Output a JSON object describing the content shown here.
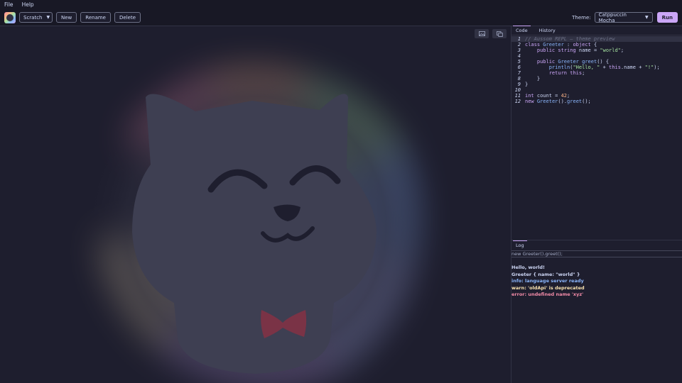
{
  "menu": {
    "file": "File",
    "help": "Help"
  },
  "toolbar": {
    "scratch_select": "Scratch",
    "new": "New",
    "rename": "Rename",
    "delete": "Delete",
    "theme_label": "Theme:",
    "theme_value": "Catppuccin Mocha",
    "run": "Run"
  },
  "editor": {
    "tabs": [
      "Code",
      "History"
    ],
    "lines": [
      {
        "n": "1",
        "text": "// Aussom REPL — theme preview"
      },
      {
        "n": "2",
        "text": "class Greeter : object {"
      },
      {
        "n": "3",
        "text": "    public string name = \"world\";"
      },
      {
        "n": "4",
        "text": ""
      },
      {
        "n": "5",
        "text": "    public Greeter greet() {"
      },
      {
        "n": "6",
        "text": "        println(\"Hello, \" + this.name + \"!\");"
      },
      {
        "n": "7",
        "text": "        return this;"
      },
      {
        "n": "8",
        "text": "    }"
      },
      {
        "n": "9",
        "text": "}"
      },
      {
        "n": "10",
        "text": ""
      },
      {
        "n": "11",
        "text": "int count = 42;"
      },
      {
        "n": "12",
        "text": "new Greeter().greet();"
      }
    ]
  },
  "log": {
    "tab": "Log",
    "input_value": "new Greeter().greet();",
    "lines": [
      {
        "text": "Hello, world!",
        "color": "#cdd6f4"
      },
      {
        "text": "Greeter { name: \"world\" }",
        "color": "#cdd6f4"
      },
      {
        "text": "info: language server ready",
        "color": "#89b4fa"
      },
      {
        "text": "warn: 'oldApi' is deprecated",
        "color": "#f9e2af"
      },
      {
        "text": "error: undefined name 'xyz'",
        "color": "#f38ba8"
      }
    ]
  },
  "preview_tools": [
    "image-icon",
    "copy-icon"
  ],
  "colors": {
    "accent": "#cba6f7",
    "base": "#1e1e2e",
    "mantle": "#181825",
    "comment": "#6c7086",
    "keyword": "#cba6f7",
    "type": "#89b4fa",
    "string": "#a6e3a1",
    "number": "#fab387",
    "function": "#89b4fa"
  }
}
